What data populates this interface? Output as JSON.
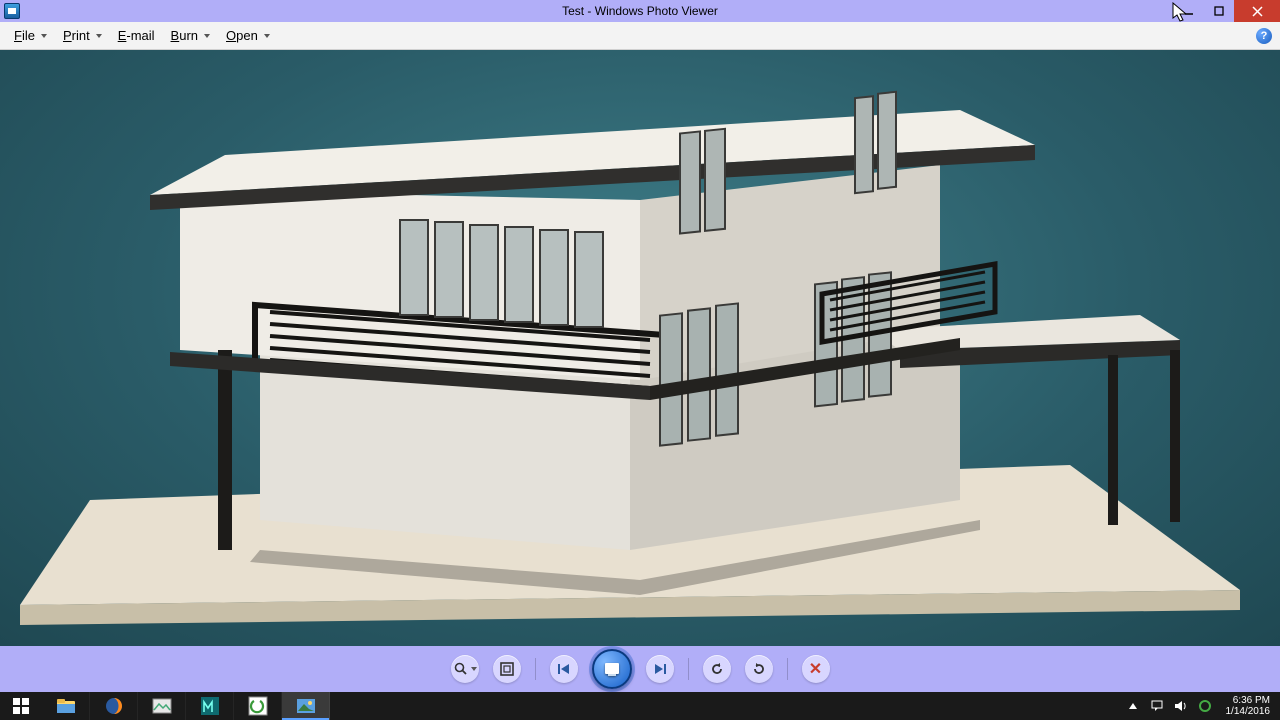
{
  "window": {
    "title": "Test - Windows Photo Viewer"
  },
  "menu": {
    "file": "File",
    "print": "Print",
    "email": "E-mail",
    "burn": "Burn",
    "open": "Open"
  },
  "controls": {
    "zoom": "zoom",
    "fit": "fit-to-window",
    "prev": "previous",
    "play": "play-slideshow",
    "next": "next",
    "rotate_ccw": "rotate-counterclockwise",
    "rotate_cw": "rotate-clockwise",
    "delete": "delete"
  },
  "taskbar": {
    "items": [
      {
        "name": "start"
      },
      {
        "name": "file-explorer"
      },
      {
        "name": "firefox"
      },
      {
        "name": "image-app"
      },
      {
        "name": "autodesk-maya"
      },
      {
        "name": "camtasia"
      },
      {
        "name": "photo-viewer",
        "active": true
      }
    ]
  },
  "tray": {
    "time": "6:36 PM",
    "date": "1/14/2016"
  }
}
